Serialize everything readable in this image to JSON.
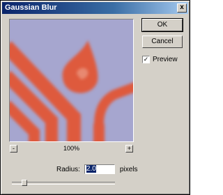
{
  "window": {
    "title": "Gaussian Blur",
    "close_glyph": "x"
  },
  "buttons": {
    "ok_label": "OK",
    "cancel_label": "Cancel"
  },
  "preview_option": {
    "label": "Preview",
    "checked": true,
    "check_glyph": "✓"
  },
  "zoom": {
    "out_glyph": "-",
    "in_glyph": "+",
    "level": "100%"
  },
  "radius": {
    "label": "Radius:",
    "value": "2.0",
    "unit": "pixels",
    "slider_fraction": 0.1
  },
  "colors": {
    "preview_background": "#a6a6cf",
    "shape_fill": "#de5a3c"
  }
}
